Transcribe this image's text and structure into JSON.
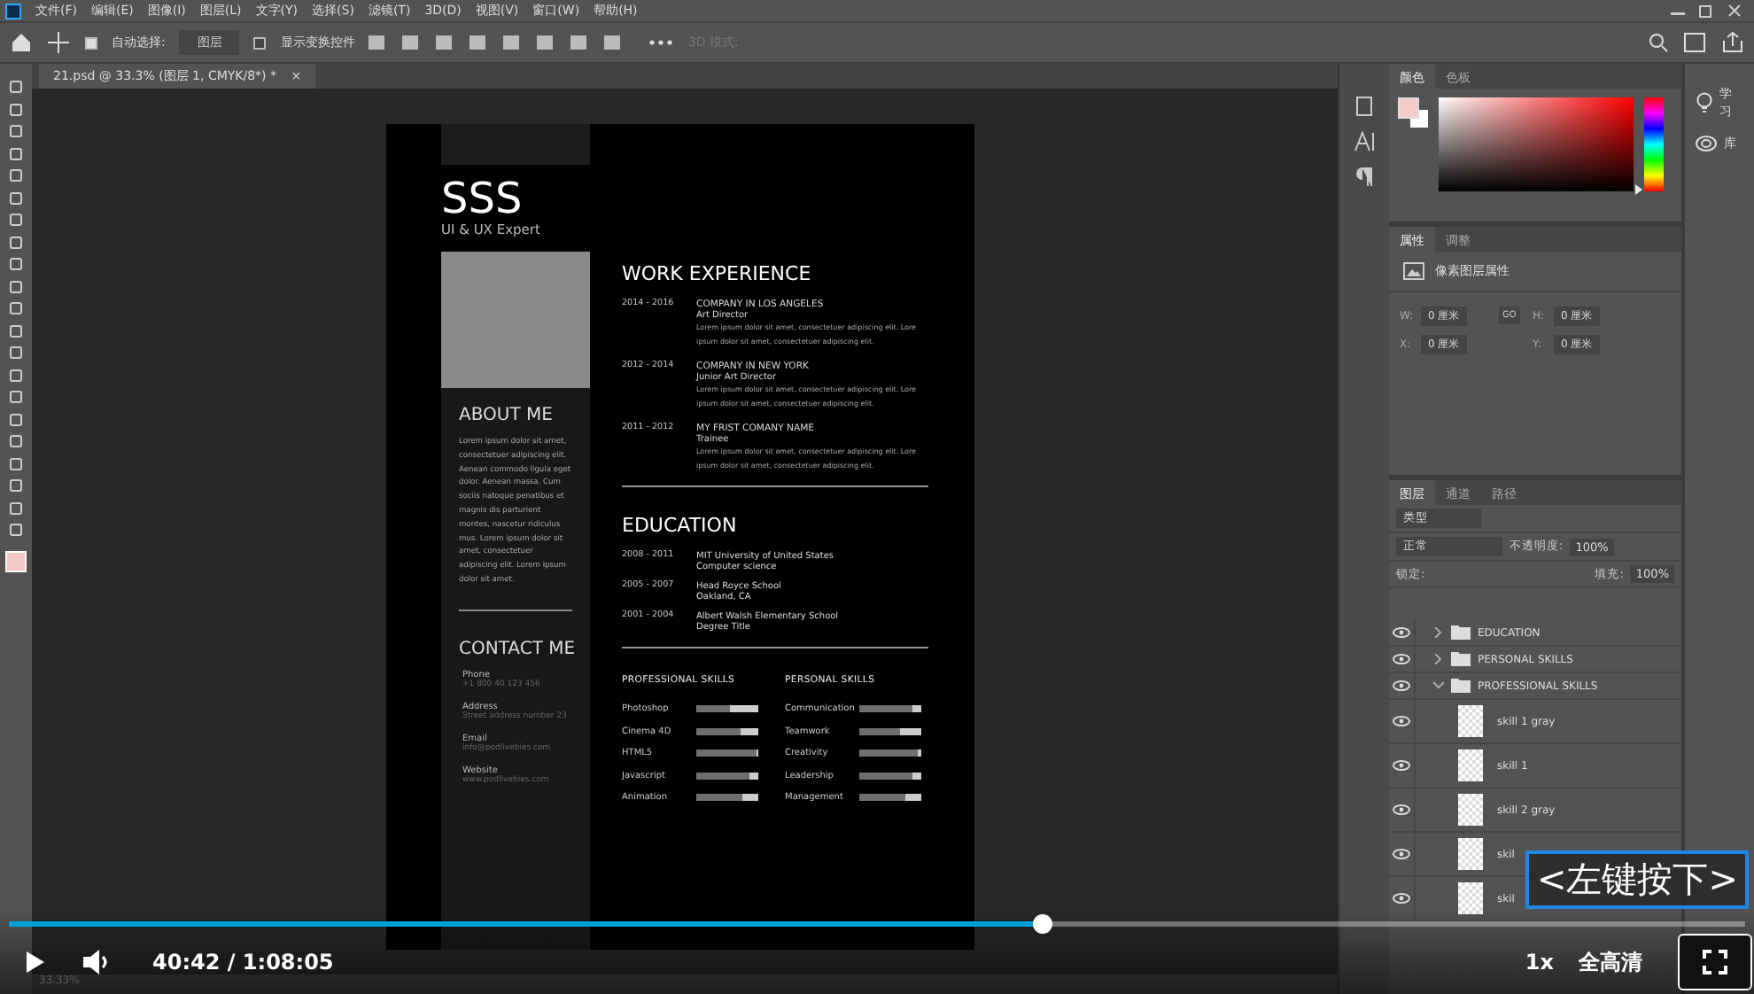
{
  "menu_bar": {
    "items": [
      "文件(F)",
      "编辑(E)",
      "图像(I)",
      "图层(L)",
      "文字(Y)",
      "选择(S)",
      "滤镜(T)",
      "3D(D)",
      "视图(V)",
      "窗口(W)",
      "帮助(H)"
    ]
  },
  "options_bar": {
    "auto_select": {
      "label": "自动选择:",
      "checked": true
    },
    "auto_select_target": "图层",
    "show_transform": {
      "label": "显示变换控件",
      "checked": false
    },
    "mode_3d": {
      "label": "3D 模式:",
      "disabled": true
    }
  },
  "document_tab": {
    "title": "21.psd @ 33.3% (图层 1, CMYK/8*) *",
    "close": "×"
  },
  "resume": {
    "name": "SSS",
    "subtitle": "UI & UX Expert",
    "about": {
      "heading": "ABOUT ME",
      "text": "Lorem ipsum dolor sit amet, consectetuer adipiscing elit. Aenean commodo ligula eget dolor. Aenean massa. Cum sociis natoque penatibus et magnis dis parturient montes, nascetur ridiculus mus. Lorem ipsum dolor sit amet, consectetuer adipiscing elit. Lorem ipsum dolor sit amet."
    },
    "contact": {
      "heading": "CONTACT ME",
      "items": [
        {
          "label": "Phone",
          "value": "+1 800 40 123 456"
        },
        {
          "label": "Address",
          "value": "Street address number 23"
        },
        {
          "label": "Email",
          "value": "info@podlivebies.com"
        },
        {
          "label": "Website",
          "value": "www.podlivebies.com"
        }
      ]
    },
    "work": {
      "heading": "WORK EXPERIENCE",
      "items": [
        {
          "dates": "2014 - 2016",
          "company": "COMPANY IN LOS ANGELES",
          "role": "Art Director",
          "text": "Lorem ipsum dolor sit amet, consectetuer adipiscing elit. Lore ipsum dolor sit amet, consectetuer adipiscing elit."
        },
        {
          "dates": "2012 - 2014",
          "company": "COMPANY IN NEW YORK",
          "role": "Junior Art Director",
          "text": "Lorem ipsum dolor sit amet, consectetuer adipiscing elit. Lore ipsum dolor sit amet, consectetuer adipiscing elit."
        },
        {
          "dates": "2011 - 2012",
          "company": "MY FRIST COMANY NAME",
          "role": "Trainee",
          "text": "Lorem ipsum dolor sit amet, consectetuer adipiscing elit. Lore ipsum dolor sit amet, consectetuer adipiscing elit."
        }
      ]
    },
    "education": {
      "heading": "EDUCATION",
      "items": [
        {
          "dates": "2008 - 2011",
          "school": "MIT University of United States",
          "detail": "Computer science"
        },
        {
          "dates": "2005 - 2007",
          "school": "Head Royce School",
          "detail": "Oakland, CA"
        },
        {
          "dates": "2001 - 2004",
          "school": "Albert Walsh Elementary School",
          "detail": "Degree Title"
        }
      ]
    },
    "skill_groups": [
      {
        "heading": "PROFESSIONAL SKILLS",
        "skills": [
          {
            "name": "Photoshop",
            "level": 0.53
          },
          {
            "name": "Cinema 4D",
            "level": 0.72
          },
          {
            "name": "HTML5",
            "level": 0.97
          },
          {
            "name": "Javascript",
            "level": 0.86
          },
          {
            "name": "Animation",
            "level": 0.75
          }
        ]
      },
      {
        "heading": "PERSONAL SKILLS",
        "skills": [
          {
            "name": "Communication",
            "level": 0.85
          },
          {
            "name": "Teamwork",
            "level": 0.67
          },
          {
            "name": "Creativity",
            "level": 0.95
          },
          {
            "name": "Leadership",
            "level": 0.86
          },
          {
            "name": "Management",
            "level": 0.74
          }
        ]
      }
    ]
  },
  "status_bar": {
    "zoom": "33.33%"
  },
  "color_panel": {
    "tabs": [
      {
        "label": "颜色",
        "selected": true
      },
      {
        "label": "色板",
        "selected": false
      }
    ],
    "hue_slider": {
      "level": 0.02
    }
  },
  "properties_panel": {
    "tabs": [
      {
        "label": "属性",
        "selected": true
      },
      {
        "label": "调整",
        "selected": false
      }
    ],
    "layer_type": "像素图层属性",
    "fields": [
      {
        "label": "W:",
        "value": "0 厘米"
      },
      {
        "label": "H:",
        "value": "0 厘米"
      },
      {
        "label": "X:",
        "value": "0 厘米"
      },
      {
        "label": "Y:",
        "value": "0 厘米"
      }
    ],
    "link": "GO"
  },
  "layers_panel": {
    "tabs": [
      {
        "label": "图层",
        "selected": true
      },
      {
        "label": "通道",
        "selected": false
      },
      {
        "label": "路径",
        "selected": false
      }
    ],
    "filter": "类型",
    "blend_mode": "正常",
    "opacity_label": "不透明度:",
    "opacity": "100%",
    "lock_label": "锁定:",
    "fill_label": "填充:",
    "fill": "100%",
    "layers": [
      {
        "kind": "folder",
        "name": "EDUCATION",
        "visible": true,
        "expanded": false
      },
      {
        "kind": "folder",
        "name": "PERSONAL SKILLS",
        "visible": true,
        "expanded": false
      },
      {
        "kind": "folder",
        "name": "PROFESSIONAL SKILLS",
        "visible": true,
        "expanded": true,
        "children": [
          {
            "kind": "layer",
            "name": "skill 1 gray",
            "visible": true
          },
          {
            "kind": "layer",
            "name": "skill 1",
            "visible": true
          },
          {
            "kind": "layer",
            "name": "skill 2 gray",
            "visible": true
          },
          {
            "kind": "layer",
            "name": "skil",
            "visible": true
          },
          {
            "kind": "layer",
            "name": "skil",
            "visible": true
          }
        ]
      }
    ]
  },
  "side_panels": [
    {
      "label": "学习"
    },
    {
      "label": "库"
    }
  ],
  "video_player": {
    "progress": {
      "level": 0.595
    },
    "time": "40:42 / 1:08:05",
    "speed": "1x",
    "quality": "全高清",
    "overlay_hint": "<左键按下>"
  }
}
